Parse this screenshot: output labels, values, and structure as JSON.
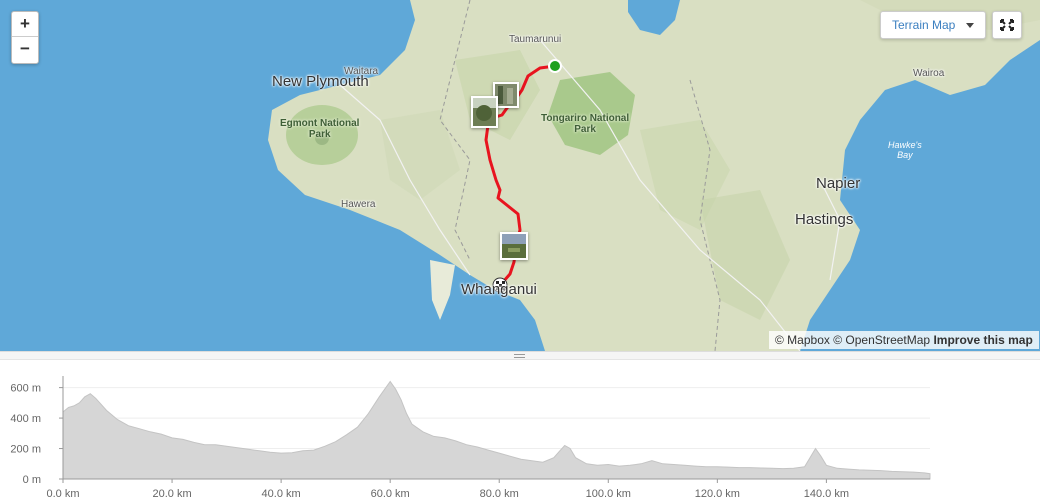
{
  "map": {
    "places": {
      "taumarunui": "Taumarunui",
      "waitara": "Waitara",
      "new_plymouth": "New Plymouth",
      "egmont": "Egmont National\nPark",
      "tongariro": "Tongariro National\nPark",
      "hawera": "Hawera",
      "whanganui": "Whanganui",
      "napier": "Napier",
      "hastings": "Hastings",
      "wairoa": "Wairoa",
      "hawkes_bay": "Hawke's\nBay"
    },
    "controls": {
      "zoom_in": "+",
      "zoom_out": "−",
      "terrain_label": "Terrain Map"
    },
    "attribution": {
      "mapbox": "© Mapbox",
      "osm": "© OpenStreetMap",
      "improve": "Improve this map"
    },
    "colors": {
      "route": "#e8141f",
      "start": "#1ea01e",
      "water": "#5fa8d8",
      "land": "#d9dfc2",
      "park": "#a9c98c"
    }
  },
  "elevation": {
    "y_ticks": [
      "0 m",
      "200 m",
      "400 m",
      "600 m"
    ],
    "x_ticks": [
      "0.0 km",
      "20.0 km",
      "40.0 km",
      "60.0 km",
      "80.0 km",
      "100.0 km",
      "120.0 km",
      "140.0 km"
    ],
    "fill_color": "#d6d6d6",
    "chart_data": {
      "type": "area",
      "x_unit": "km",
      "y_unit": "m",
      "xlim": [
        0,
        159
      ],
      "ylim": [
        0,
        650
      ],
      "points": [
        [
          0,
          440
        ],
        [
          1,
          470
        ],
        [
          2,
          480
        ],
        [
          3,
          500
        ],
        [
          4,
          540
        ],
        [
          5,
          560
        ],
        [
          6,
          530
        ],
        [
          7,
          490
        ],
        [
          8,
          450
        ],
        [
          10,
          390
        ],
        [
          12,
          350
        ],
        [
          14,
          330
        ],
        [
          16,
          310
        ],
        [
          18,
          295
        ],
        [
          20,
          270
        ],
        [
          22,
          260
        ],
        [
          24,
          240
        ],
        [
          26,
          225
        ],
        [
          28,
          225
        ],
        [
          30,
          215
        ],
        [
          32,
          205
        ],
        [
          34,
          195
        ],
        [
          36,
          185
        ],
        [
          38,
          175
        ],
        [
          40,
          170
        ],
        [
          42,
          172
        ],
        [
          44,
          185
        ],
        [
          46,
          190
        ],
        [
          48,
          215
        ],
        [
          50,
          245
        ],
        [
          52,
          290
        ],
        [
          54,
          340
        ],
        [
          56,
          430
        ],
        [
          58,
          540
        ],
        [
          60,
          640
        ],
        [
          61,
          590
        ],
        [
          62,
          520
        ],
        [
          63,
          430
        ],
        [
          64,
          360
        ],
        [
          66,
          310
        ],
        [
          68,
          280
        ],
        [
          70,
          270
        ],
        [
          72,
          250
        ],
        [
          74,
          225
        ],
        [
          76,
          210
        ],
        [
          78,
          190
        ],
        [
          80,
          170
        ],
        [
          82,
          150
        ],
        [
          84,
          130
        ],
        [
          86,
          120
        ],
        [
          88,
          110
        ],
        [
          89,
          125
        ],
        [
          90,
          140
        ],
        [
          91,
          180
        ],
        [
          92,
          220
        ],
        [
          93,
          200
        ],
        [
          94,
          140
        ],
        [
          96,
          100
        ],
        [
          98,
          90
        ],
        [
          100,
          95
        ],
        [
          102,
          85
        ],
        [
          104,
          90
        ],
        [
          106,
          100
        ],
        [
          108,
          120
        ],
        [
          110,
          100
        ],
        [
          112,
          95
        ],
        [
          114,
          90
        ],
        [
          116,
          85
        ],
        [
          118,
          80
        ],
        [
          120,
          80
        ],
        [
          122,
          78
        ],
        [
          124,
          75
        ],
        [
          126,
          75
        ],
        [
          128,
          72
        ],
        [
          130,
          70
        ],
        [
          132,
          68
        ],
        [
          134,
          70
        ],
        [
          136,
          80
        ],
        [
          137,
          140
        ],
        [
          138,
          200
        ],
        [
          139,
          150
        ],
        [
          140,
          90
        ],
        [
          142,
          70
        ],
        [
          144,
          65
        ],
        [
          146,
          60
        ],
        [
          148,
          58
        ],
        [
          150,
          55
        ],
        [
          152,
          50
        ],
        [
          154,
          48
        ],
        [
          156,
          45
        ],
        [
          158,
          40
        ],
        [
          159,
          35
        ]
      ]
    }
  }
}
